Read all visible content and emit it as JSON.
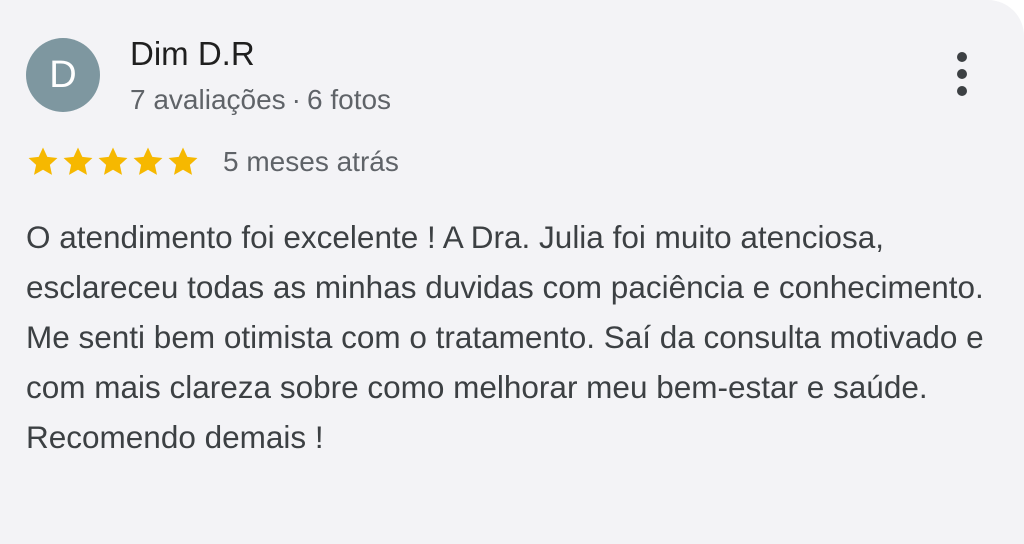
{
  "review": {
    "author": {
      "initial": "D",
      "name": "Dim D.R",
      "reviews_count": "7 avaliações",
      "separator": "·",
      "photos_count": "6 fotos"
    },
    "rating": {
      "stars": 5,
      "max_stars": 5,
      "star_color": "#f6b800"
    },
    "time": "5 meses atrás",
    "text": "O atendimento foi excelente ! A Dra. Julia foi muito atenciosa, esclareceu todas as minhas duvidas com paciência e conhecimento. Me senti bem otimista com o tratamento. Saí da consulta motivado e com mais clareza sobre como melhorar meu bem-estar e saúde. Recomendo demais !",
    "more_icon": "more-vert-icon",
    "colors": {
      "avatar_bg": "#7e97a0",
      "card_bg": "#f3f3f6"
    }
  }
}
